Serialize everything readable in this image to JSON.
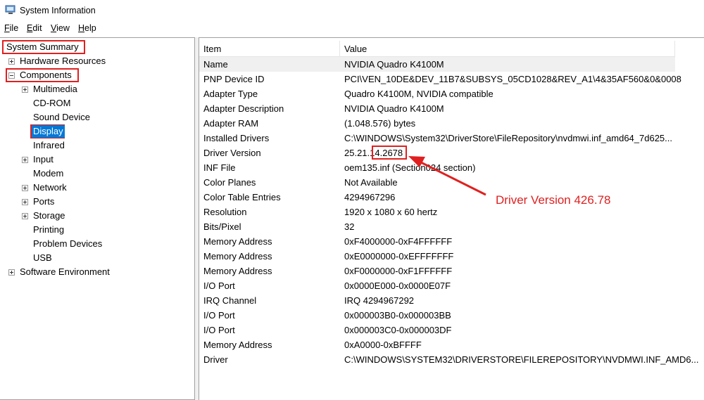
{
  "window": {
    "title": "System Information",
    "icon": "system-information-icon"
  },
  "menu": [
    {
      "label": "File",
      "accel": "F",
      "rest": "ile"
    },
    {
      "label": "Edit",
      "accel": "E",
      "rest": "dit"
    },
    {
      "label": "View",
      "accel": "V",
      "rest": "iew"
    },
    {
      "label": "Help",
      "accel": "H",
      "rest": "elp"
    }
  ],
  "tree": {
    "root": "System Summary",
    "hardware": "Hardware Resources",
    "components": "Components",
    "children": [
      "Multimedia",
      "CD-ROM",
      "Sound Device",
      "Display",
      "Infrared",
      "Input",
      "Modem",
      "Network",
      "Ports",
      "Storage",
      "Printing",
      "Problem Devices",
      "USB"
    ],
    "software": "Software Environment"
  },
  "list": {
    "headers": {
      "item": "Item",
      "value": "Value"
    },
    "rows": [
      {
        "item": "Name",
        "value": "NVIDIA Quadro K4100M"
      },
      {
        "item": "PNP Device ID",
        "value": "PCI\\VEN_10DE&DEV_11B7&SUBSYS_05CD1028&REV_A1\\4&35AF560&0&0008"
      },
      {
        "item": "Adapter Type",
        "value": "Quadro K4100M, NVIDIA compatible"
      },
      {
        "item": "Adapter Description",
        "value": "NVIDIA Quadro K4100M"
      },
      {
        "item": "Adapter RAM",
        "value": "(1.048.576) bytes"
      },
      {
        "item": "Installed Drivers",
        "value": "C:\\WINDOWS\\System32\\DriverStore\\FileRepository\\nvdmwi.inf_amd64_7d625..."
      },
      {
        "item": "Driver Version",
        "value": "25.21.14.2678"
      },
      {
        "item": "INF File",
        "value": "oem135.inf (Section024 section)"
      },
      {
        "item": "Color Planes",
        "value": "Not Available"
      },
      {
        "item": "Color Table Entries",
        "value": "4294967296"
      },
      {
        "item": "Resolution",
        "value": "1920 x 1080 x 60 hertz"
      },
      {
        "item": "Bits/Pixel",
        "value": "32"
      },
      {
        "item": "Memory Address",
        "value": "0xF4000000-0xF4FFFFFF"
      },
      {
        "item": "Memory Address",
        "value": "0xE0000000-0xEFFFFFFF"
      },
      {
        "item": "Memory Address",
        "value": "0xF0000000-0xF1FFFFFF"
      },
      {
        "item": "I/O Port",
        "value": "0x0000E000-0x0000E07F"
      },
      {
        "item": "IRQ Channel",
        "value": "IRQ 4294967292"
      },
      {
        "item": "I/O Port",
        "value": "0x000003B0-0x000003BB"
      },
      {
        "item": "I/O Port",
        "value": "0x000003C0-0x000003DF"
      },
      {
        "item": "Memory Address",
        "value": "0xA0000-0xBFFFF"
      },
      {
        "item": "Driver",
        "value": "C:\\WINDOWS\\SYSTEM32\\DRIVERSTORE\\FILEREPOSITORY\\NVDMWI.INF_AMD6..."
      }
    ]
  },
  "annotation": {
    "text": "Driver Version 426.78",
    "color": "#e02020"
  },
  "colors": {
    "highlight": "#e02020",
    "selection": "#0078d7"
  }
}
